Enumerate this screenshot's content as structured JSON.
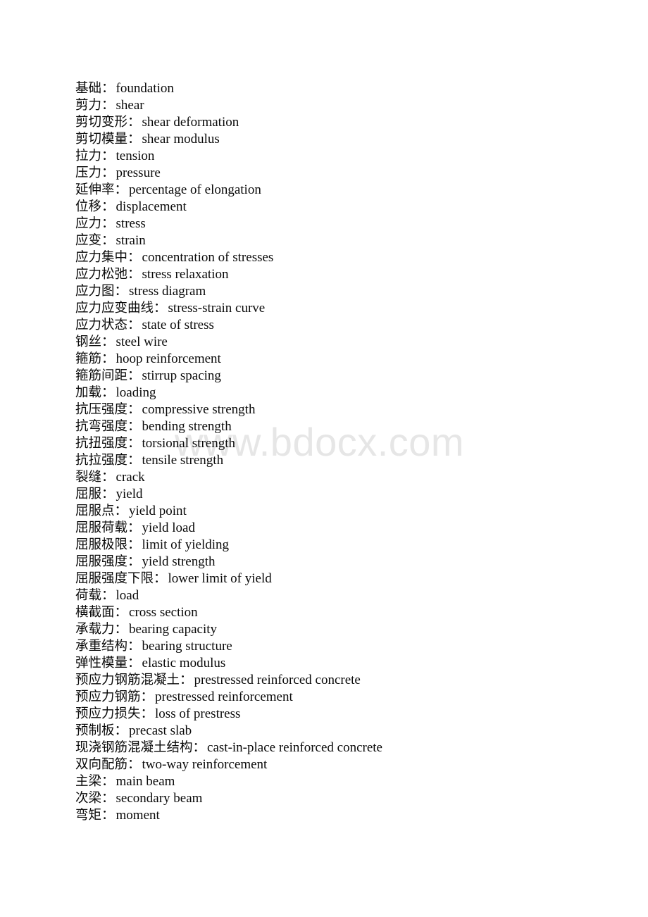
{
  "page": {
    "background_color": "#ffffff",
    "text_color": "#0a0a0a"
  },
  "watermark": {
    "text": "www.bdocx.com",
    "color": "#e6e6e6"
  },
  "glossary": {
    "separator": "：",
    "entries": [
      {
        "term": "基础",
        "definition": "foundation"
      },
      {
        "term": "剪力",
        "definition": "shear"
      },
      {
        "term": "剪切变形",
        "definition": "shear deformation"
      },
      {
        "term": "剪切模量",
        "definition": "shear modulus"
      },
      {
        "term": "拉力",
        "definition": "tension"
      },
      {
        "term": "压力",
        "definition": "pressure"
      },
      {
        "term": "延伸率",
        "definition": "percentage of elongation"
      },
      {
        "term": "位移",
        "definition": "displacement"
      },
      {
        "term": "应力",
        "definition": "stress"
      },
      {
        "term": "应变",
        "definition": "strain"
      },
      {
        "term": "应力集中",
        "definition": "concentration of stresses"
      },
      {
        "term": "应力松弛",
        "definition": "stress relaxation"
      },
      {
        "term": "应力图",
        "definition": "stress diagram"
      },
      {
        "term": "应力应变曲线",
        "definition": "stress-strain curve"
      },
      {
        "term": "应力状态",
        "definition": "state of stress"
      },
      {
        "term": "钢丝",
        "definition": "steel wire"
      },
      {
        "term": "箍筋",
        "definition": "hoop reinforcement"
      },
      {
        "term": "箍筋间距",
        "definition": "stirrup spacing"
      },
      {
        "term": "加载",
        "definition": "loading"
      },
      {
        "term": "抗压强度",
        "definition": "compressive strength"
      },
      {
        "term": "抗弯强度",
        "definition": "bending strength"
      },
      {
        "term": "抗扭强度",
        "definition": "torsional strength"
      },
      {
        "term": "抗拉强度",
        "definition": "tensile strength"
      },
      {
        "term": "裂缝",
        "definition": "crack"
      },
      {
        "term": "屈服",
        "definition": "yield"
      },
      {
        "term": "屈服点",
        "definition": "yield point"
      },
      {
        "term": "屈服荷载",
        "definition": "yield load"
      },
      {
        "term": "屈服极限",
        "definition": "limit of yielding"
      },
      {
        "term": "屈服强度",
        "definition": "yield strength"
      },
      {
        "term": "屈服强度下限",
        "definition": "lower limit of yield"
      },
      {
        "term": "荷载",
        "definition": "load"
      },
      {
        "term": "横截面",
        "definition": "cross section"
      },
      {
        "term": "承载力",
        "definition": "bearing capacity"
      },
      {
        "term": "承重结构",
        "definition": "bearing structure"
      },
      {
        "term": "弹性模量",
        "definition": "elastic modulus"
      },
      {
        "term": "预应力钢筋混凝土",
        "definition": "prestressed reinforced concrete"
      },
      {
        "term": "预应力钢筋",
        "definition": "prestressed reinforcement"
      },
      {
        "term": "预应力损失",
        "definition": "loss of prestress"
      },
      {
        "term": "预制板",
        "definition": "precast slab"
      },
      {
        "term": "现浇钢筋混凝土结构",
        "definition": "cast-in-place reinforced concrete"
      },
      {
        "term": "双向配筋",
        "definition": "two-way reinforcement"
      },
      {
        "term": "主梁",
        "definition": "main beam"
      },
      {
        "term": "次梁",
        "definition": "secondary beam"
      },
      {
        "term": "弯矩",
        "definition": "moment"
      }
    ]
  }
}
